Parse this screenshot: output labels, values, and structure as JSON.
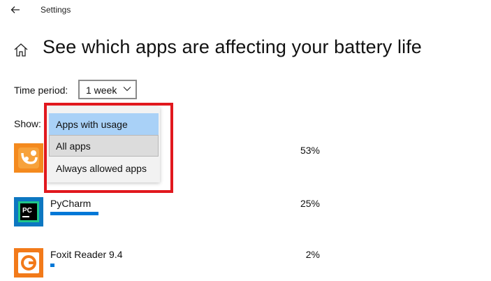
{
  "window": {
    "title": "Settings"
  },
  "page": {
    "title": "See which apps are affecting your battery life"
  },
  "time_period": {
    "label": "Time period:",
    "value": "1 week"
  },
  "show": {
    "label": "Show:",
    "options": [
      {
        "label": "Apps with usage",
        "state": "selected"
      },
      {
        "label": "All apps",
        "state": "hovered"
      },
      {
        "label": "Always allowed apps",
        "state": "normal"
      }
    ]
  },
  "apps": [
    {
      "name": "",
      "percent": "53%",
      "usage": 0.53,
      "icon": "uc-browser-icon"
    },
    {
      "name": "PyCharm",
      "percent": "25%",
      "usage": 0.25,
      "icon": "pycharm-icon"
    },
    {
      "name": "Foxit Reader 9.4",
      "percent": "2%",
      "usage": 0.02,
      "icon": "foxit-reader-icon"
    }
  ],
  "colors": {
    "accent": "#0078d7",
    "highlight": "#e1181e",
    "selected": "#a9d1f7"
  }
}
